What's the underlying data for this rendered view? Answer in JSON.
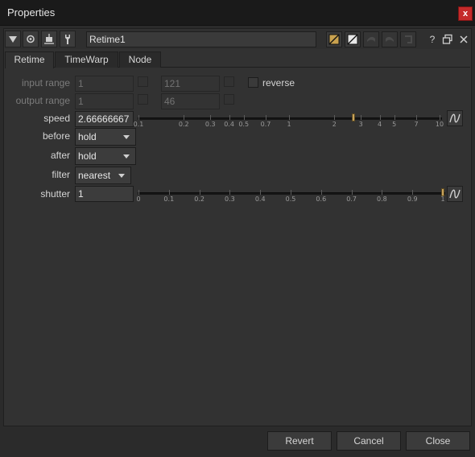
{
  "window": {
    "title": "Properties",
    "close_label": "x"
  },
  "toolbar": {
    "node_name": "Retime1",
    "help_label": "?"
  },
  "tabs": [
    "Retime",
    "TimeWarp",
    "Node"
  ],
  "fields": {
    "input_range": {
      "label": "input range",
      "first": "1",
      "last": "121"
    },
    "output_range": {
      "label": "output range",
      "first": "1",
      "last": "46"
    },
    "reverse_label": "reverse",
    "speed": {
      "label": "speed",
      "value": "2.66666667",
      "slider_ticks": [
        "0.1",
        "0.2",
        "0.3",
        "0.4",
        "0.5",
        "0.7",
        "1",
        "2",
        "3",
        "4",
        "5",
        "7",
        "10"
      ],
      "slider_value": 2.6667
    },
    "before": {
      "label": "before",
      "value": "hold"
    },
    "after": {
      "label": "after",
      "value": "hold"
    },
    "filter": {
      "label": "filter",
      "value": "nearest"
    },
    "shutter": {
      "label": "shutter",
      "value": "1",
      "slider_ticks": [
        "0",
        "0.1",
        "0.2",
        "0.3",
        "0.4",
        "0.5",
        "0.6",
        "0.7",
        "0.8",
        "0.9",
        "1"
      ],
      "slider_value": 1
    }
  },
  "footer": {
    "revert": "Revert",
    "cancel": "Cancel",
    "close": "Close"
  },
  "colors": {
    "accent_close": "#c52a2a",
    "slider_handle": "#c8a25a"
  }
}
